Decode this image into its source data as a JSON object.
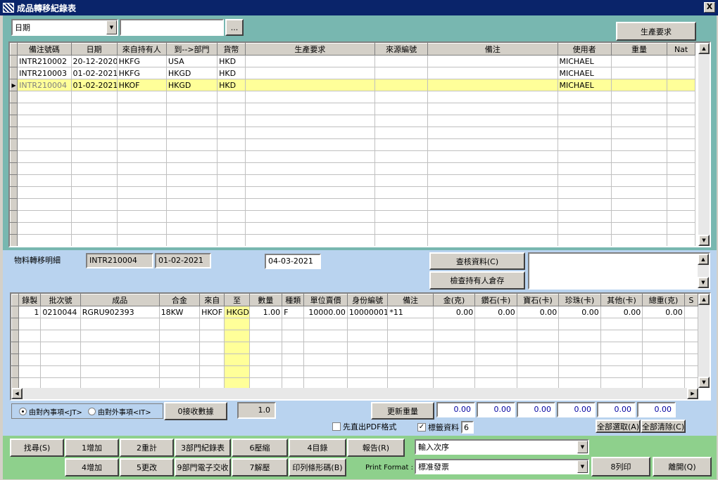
{
  "window": {
    "title": "成品轉移紀錄表",
    "close_label": "X"
  },
  "top": {
    "filter_field": "日期",
    "filter_value": "",
    "browse_label": "...",
    "prod_req_button": "生產要求",
    "columns": [
      "備注號碼",
      "日期",
      "來自持有人",
      "到-->部門",
      "貨幣",
      "生產要求",
      "來源編號",
      "備注",
      "使用者",
      "重量",
      "Nat"
    ],
    "rows": [
      [
        "INTR210002",
        "20-12-2020",
        "HKFG",
        "USA",
        "HKD",
        "",
        "",
        "",
        "MICHAEL",
        "",
        ""
      ],
      [
        "INTR210003",
        "01-02-2021",
        "HKFG",
        "HKGD",
        "HKD",
        "",
        "",
        "",
        "MICHAEL",
        "",
        ""
      ],
      [
        "INTR210004",
        "01-02-2021",
        "HKOF",
        "HKGD",
        "HKD",
        "",
        "",
        "",
        "MICHAEL",
        "",
        ""
      ]
    ]
  },
  "detail": {
    "section_label": "物料轉移明細",
    "doc_no": "INTR210004",
    "doc_date": "01-02-2021",
    "date2": "04-03-2021",
    "check_button": "查核資料(C)",
    "check_stock_button": "檢查持有人倉存",
    "columns": [
      "錄製",
      "批次號",
      "成品",
      "合金",
      "來自",
      "至",
      "數量",
      "種類",
      "單位賣價",
      "身份編號",
      "備注",
      "金(克)",
      "鑽石(卡)",
      "寶石(卡)",
      "珍珠(卡)",
      "其他(卡)",
      "總重(克)",
      "S"
    ],
    "rows": [
      [
        "1",
        "0210044",
        "RGRU902393",
        "18KW",
        "HKOF",
        "HKGD",
        "1.00",
        "F",
        "10000.00",
        "100000017",
        "*11",
        "0.00",
        "0.00",
        "0.00",
        "0.00",
        "0.00",
        "0.00",
        ""
      ]
    ],
    "radio_internal": "由對內事項<JT>",
    "radio_external": "由對外事項<IT>",
    "receive_button": "0接收數據",
    "receive_value": "1.0",
    "update_weight_button": "更新重量",
    "weights": [
      "0.00",
      "0.00",
      "0.00",
      "0.00",
      "0.00",
      "0.00"
    ],
    "pdf_label": "先直出PDF格式",
    "label_data": "標籤資料",
    "label_count": "6",
    "select_all": "全部選取(A)",
    "clear_all": "全部清除(C)"
  },
  "bottom": {
    "find": "找尋(S)",
    "add1": "1增加",
    "reset": "2重計",
    "dept_record": "3部門紀錄表",
    "compress": "6壓縮",
    "catalog": "4目錄",
    "report": "報告(R)",
    "add2": "4增加",
    "edit": "5更改",
    "dept_email": "9部門電子交收",
    "decompress": "7解壓",
    "print_barcode": "印列條形碼(B)",
    "order_combo": "輸入次序",
    "print_format_label": "Print Format :",
    "print_format": "標准發票",
    "print": "8列印",
    "exit": "離開(Q)"
  }
}
